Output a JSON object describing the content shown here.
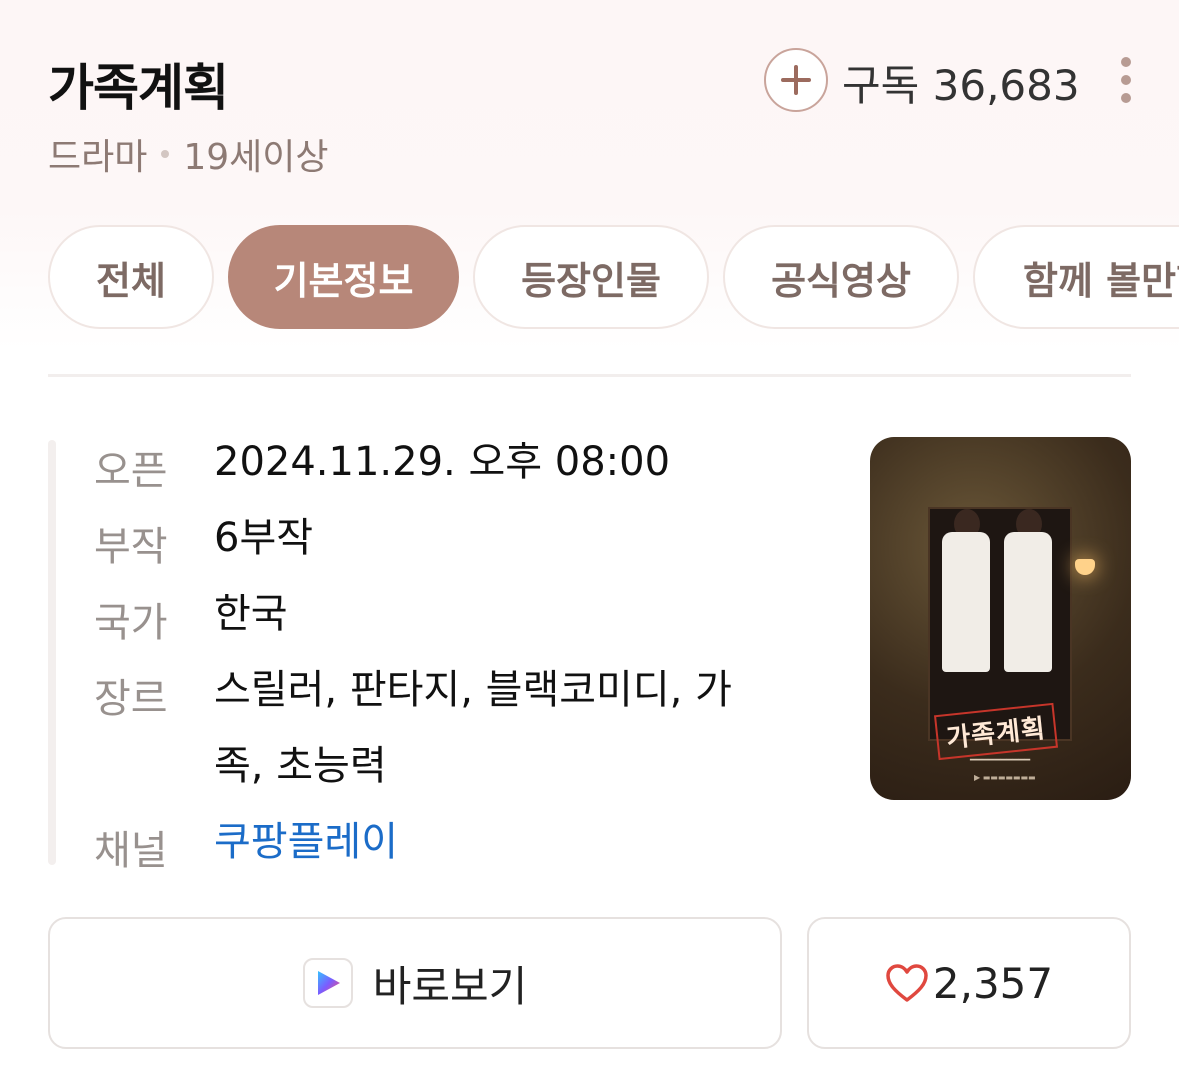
{
  "header": {
    "title": "가족계획",
    "genre": "드라마",
    "rating": "19세이상",
    "subscribe_label": "구독 36,683"
  },
  "tabs": [
    {
      "label": "전체",
      "active": false
    },
    {
      "label": "기본정보",
      "active": true
    },
    {
      "label": "등장인물",
      "active": false
    },
    {
      "label": "공식영상",
      "active": false
    },
    {
      "label": "함께 볼만한",
      "active": false
    }
  ],
  "info": {
    "open_label": "오픈",
    "open_value": "2024.11.29. 오후 08:00",
    "episodes_label": "부작",
    "episodes_value": "6부작",
    "country_label": "국가",
    "country_value": "한국",
    "genre_label": "장르",
    "genre_value_line1": "스릴러, 판타지, 블랙코미디, 가",
    "genre_value_line2": "족, 초능력",
    "channel_label": "채널",
    "channel_value": "쿠팡플레이"
  },
  "poster": {
    "title_text": "가족계획"
  },
  "actions": {
    "watch_label": "바로보기",
    "like_count": "2,357"
  },
  "colors": {
    "accent": "#b78779",
    "link": "#1b6cc8",
    "heart": "#e0483f"
  }
}
